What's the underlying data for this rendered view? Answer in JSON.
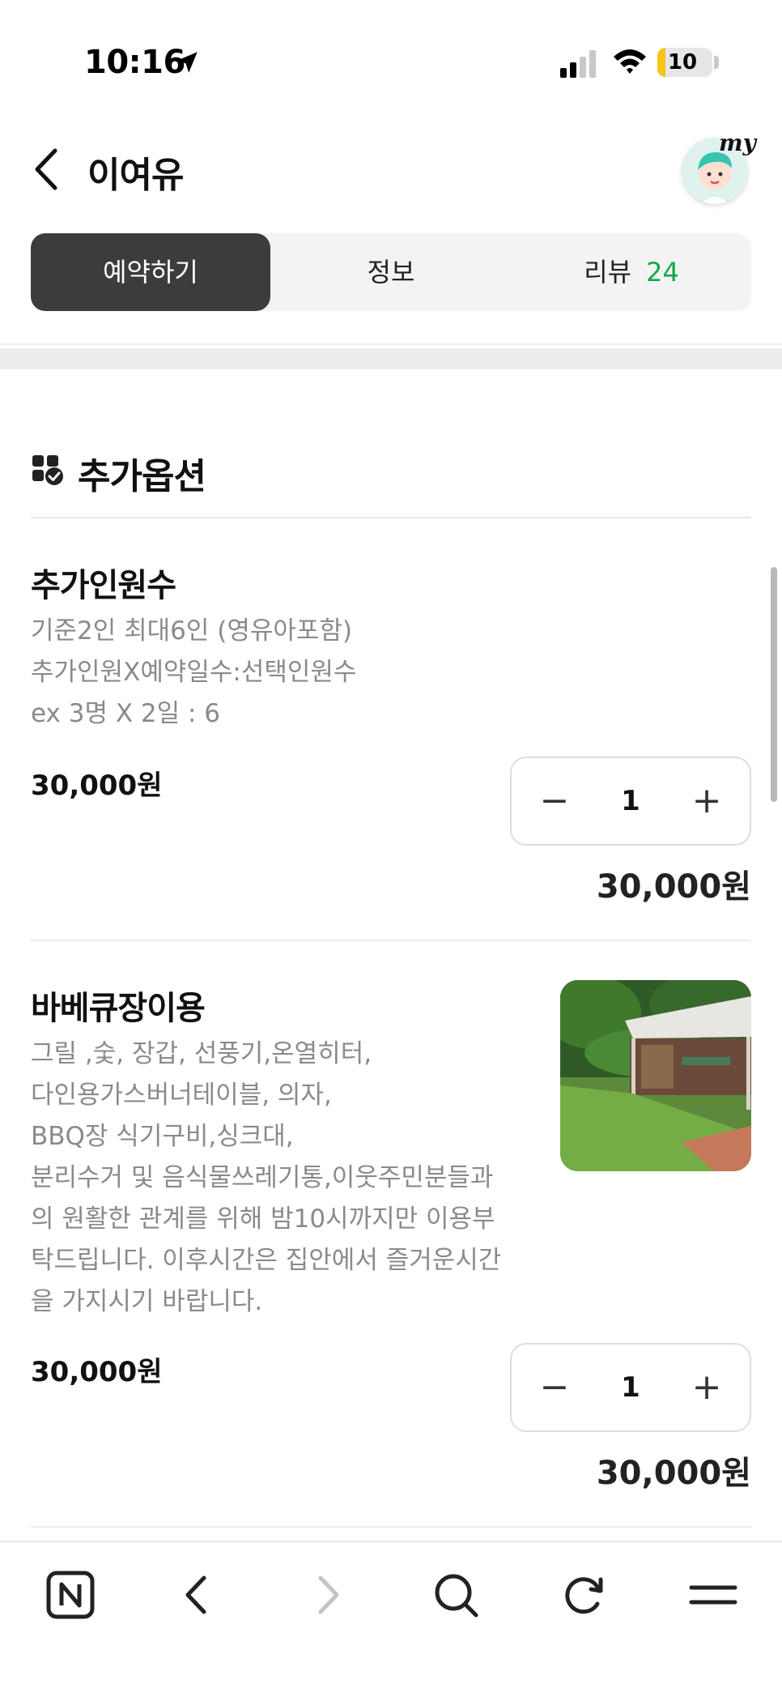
{
  "status_bar": {
    "time": "10:16",
    "battery": "10",
    "icons": [
      "location-arrow-icon",
      "signal-icon",
      "wifi-icon",
      "battery-icon"
    ]
  },
  "header": {
    "title": "이여유",
    "my_label": "my"
  },
  "tabs": [
    {
      "label": "예약하기",
      "active": true
    },
    {
      "label": "정보",
      "active": false
    },
    {
      "label": "리뷰",
      "count": "24",
      "active": false
    }
  ],
  "section": {
    "title": "추가옵션"
  },
  "options": [
    {
      "name": "추가인원수",
      "desc": [
        "기준2인 최대6인 (영유아포함)",
        "추가인원X예약일수:선택인원수",
        "ex 3명 X 2일 : 6"
      ],
      "price": "30,000원",
      "qty": "1",
      "total": "30,000원"
    },
    {
      "name": "바베큐장이용",
      "desc": [
        "그릴 ,숯, 장갑, 선풍기,온열히터,",
        "다인용가스버너테이블, 의자,",
        "BBQ장 식기구비,싱크대,",
        "분리수거 및 음식물쓰레기통,이웃주민분들과",
        "의 원활한 관계를 위해 밤10시까지만 이용부",
        "탁드립니다. 이후시간은 집안에서 즐거운시간",
        "을 가지시기 바랍니다."
      ],
      "price": "30,000원",
      "qty": "1",
      "total": "30,000원"
    }
  ],
  "stepper": {
    "minus": "−",
    "plus": "+"
  },
  "colors": {
    "accent_green": "#11a84a",
    "active_tab": "#3c3c3c"
  },
  "bottom_nav": [
    "naver-icon",
    "back-icon",
    "forward-icon",
    "search-icon",
    "reload-icon",
    "menu-icon"
  ]
}
